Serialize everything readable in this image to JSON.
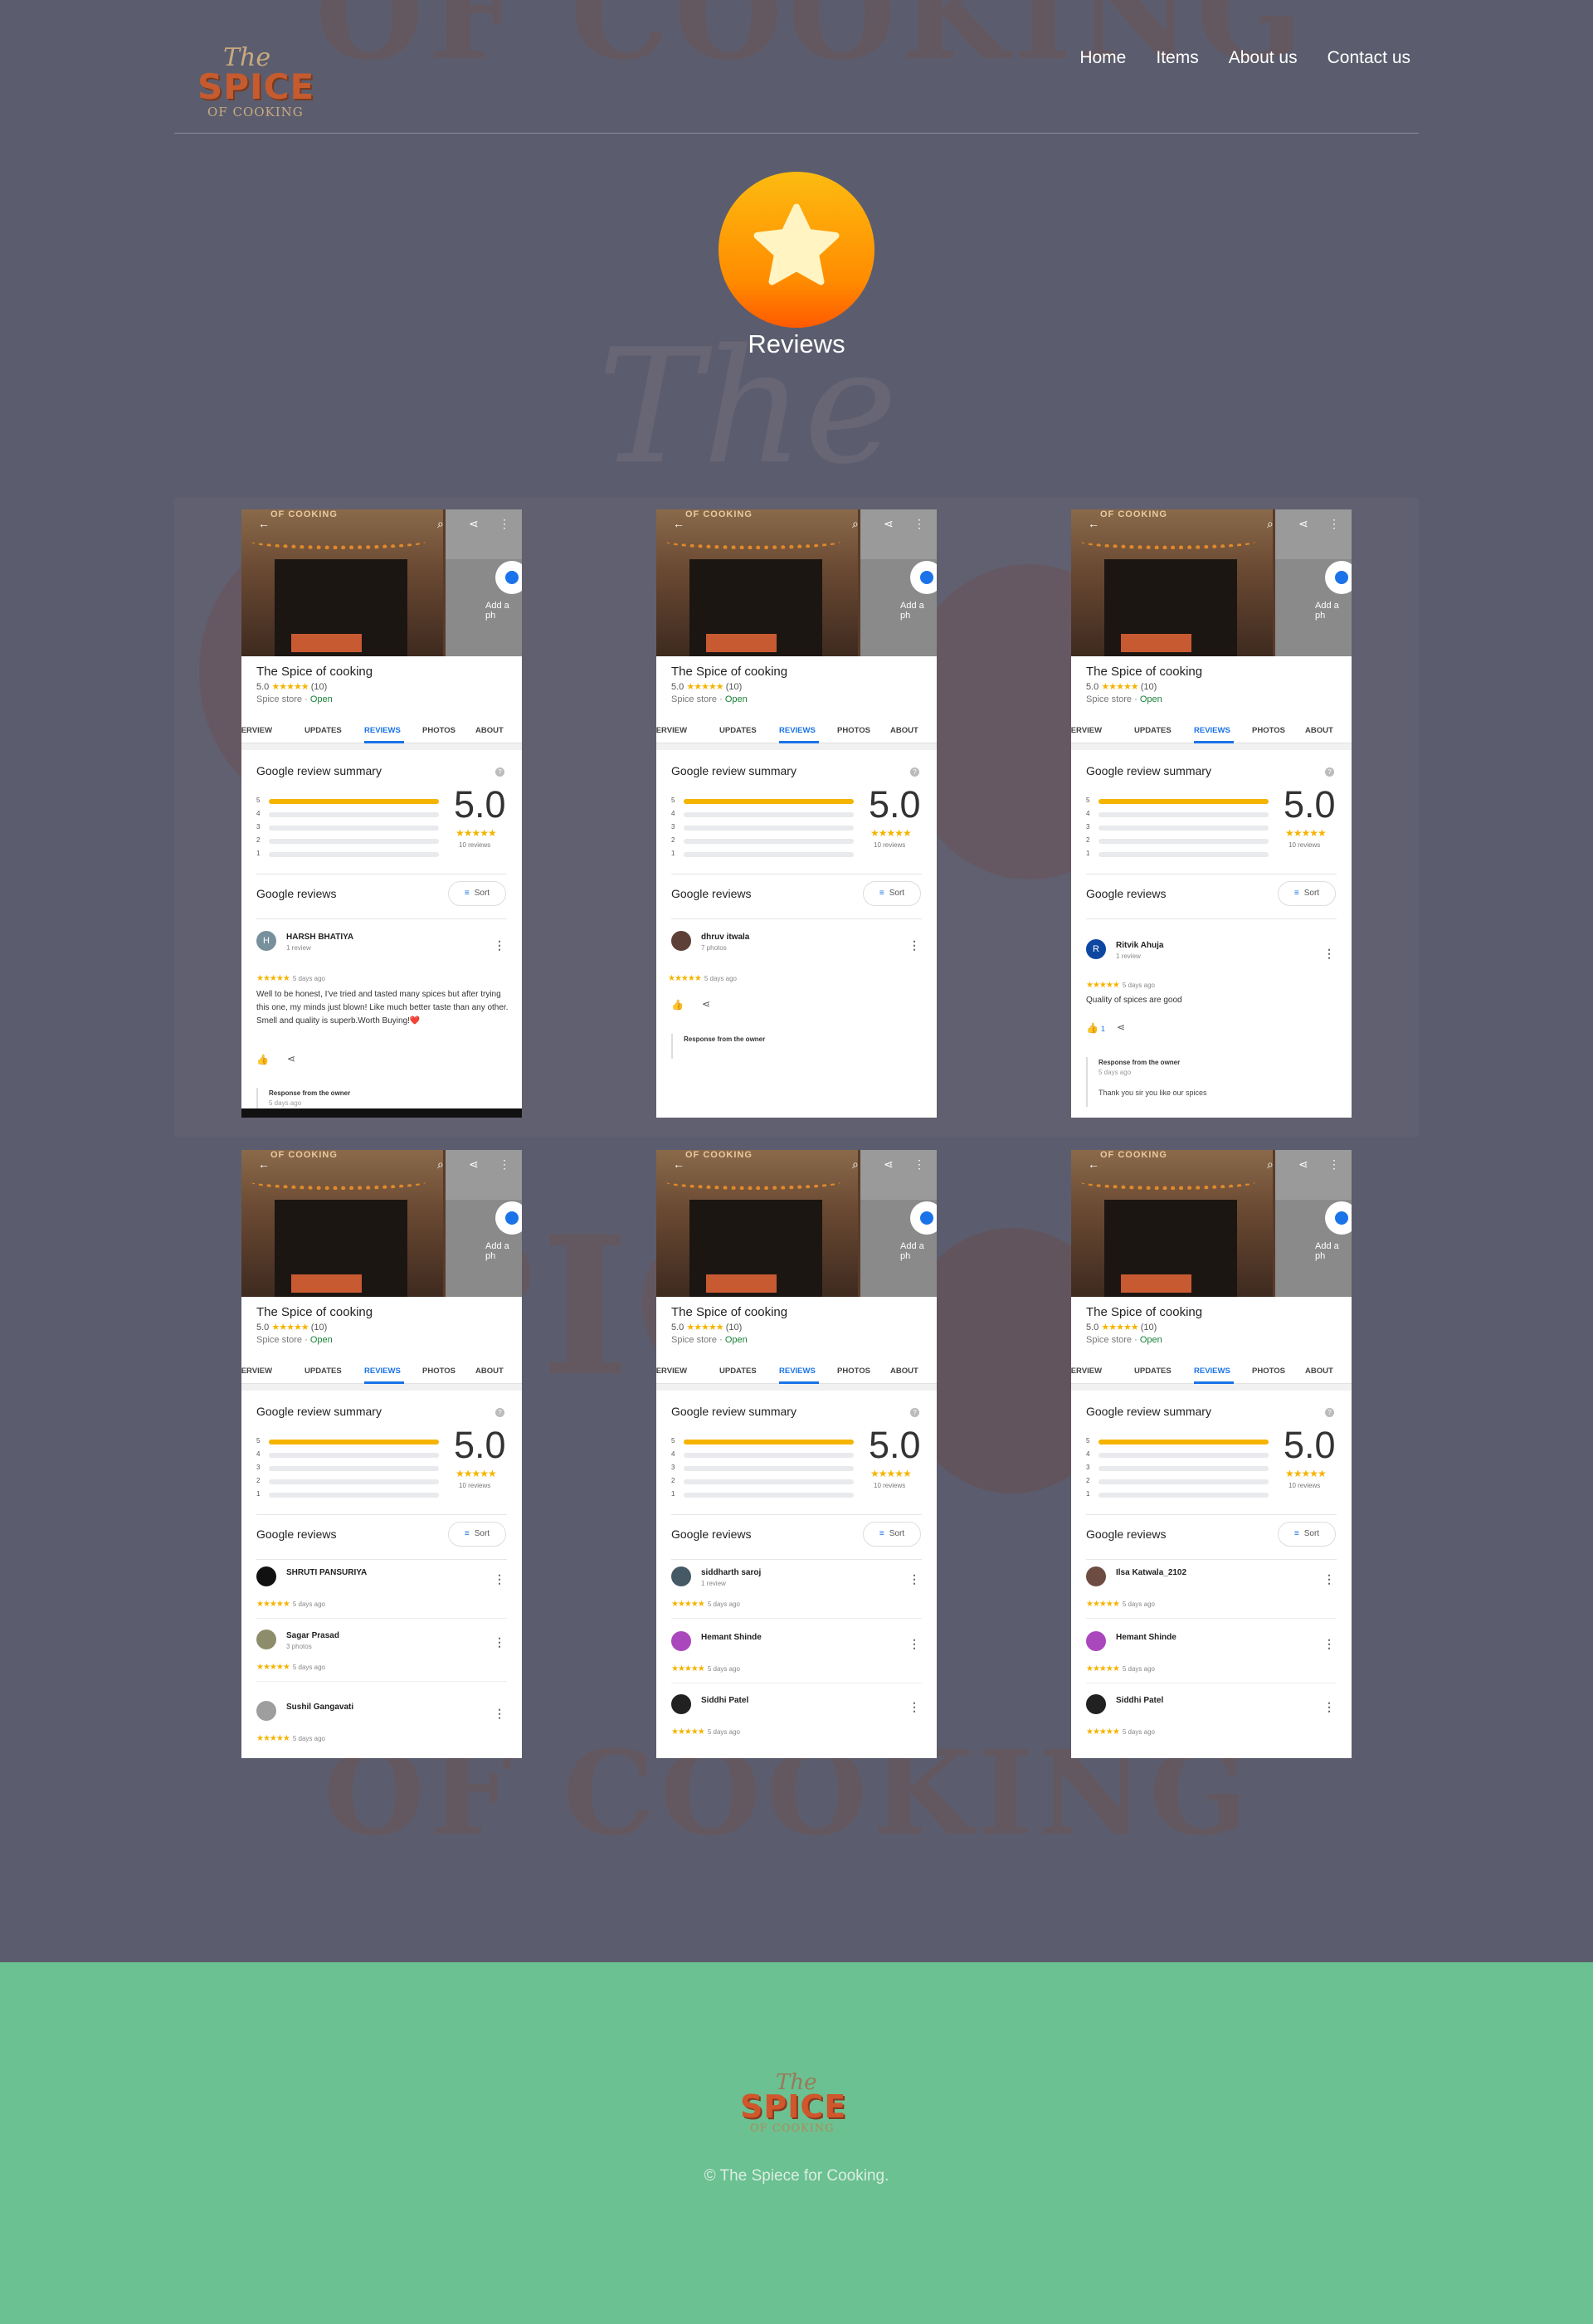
{
  "brand": {
    "logo_top": "The",
    "logo_mid": "SPICE",
    "logo_bottom": "OF COOKING"
  },
  "nav": [
    {
      "label": "Home"
    },
    {
      "label": "Items"
    },
    {
      "label": "About us"
    },
    {
      "label": "Contact us"
    }
  ],
  "hero": {
    "title": "Reviews",
    "icon": "star-icon",
    "icon_color": "#ff8c00"
  },
  "card_common": {
    "photo_top_text": "OF COOKING",
    "add_photo": "Add a ph",
    "biz_name": "The Spice of cooking",
    "biz_rating": "5.0",
    "biz_stars": "★★★★★",
    "biz_count": "(10)",
    "biz_type": "Spice store",
    "biz_open": "Open",
    "tabs": [
      "OVERVIEW",
      "UPDATES",
      "REVIEWS",
      "PHOTOS",
      "ABOUT"
    ],
    "summary_title": "Google review summary",
    "bars": [
      {
        "label": "5",
        "fraction": 1.0
      },
      {
        "label": "4",
        "fraction": 0
      },
      {
        "label": "3",
        "fraction": 0
      },
      {
        "label": "2",
        "fraction": 0
      },
      {
        "label": "1",
        "fraction": 0
      }
    ],
    "score": "5.0",
    "score_stars": "★★★★★",
    "review_count": "10 reviews",
    "reviews_title": "Google reviews",
    "sort_label": "Sort",
    "star_color": "#f5b400",
    "accent": "#1a73e8"
  },
  "cards": [
    {
      "reviews": [
        {
          "name": "HARSH BHATIYA",
          "sub": "1 review",
          "initial": "H",
          "avatar_color": "#78909c",
          "stars": "★★★★★",
          "ago": "5 days ago",
          "text": "Well to be honest, I've tried and tasted many spices but after trying this one, my minds just blown! Like much better taste than any other. Smell and quality is superb.Worth Buying!❤️"
        }
      ],
      "owner_label": "Response from the owner",
      "owner_ago": "5 days ago"
    },
    {
      "reviews": [
        {
          "name": "dhruv itwala",
          "sub": "7 photos",
          "initial": "",
          "avatar_color": "#5d4037",
          "stars": "★★★★★",
          "ago": "5 days ago",
          "text": ""
        }
      ],
      "owner_label": "Response from the owner"
    },
    {
      "reviews": [
        {
          "name": "Ritvik Ahuja",
          "sub": "1 review",
          "initial": "R",
          "avatar_color": "#0d47a1",
          "stars": "★★★★★",
          "ago": "5 days ago",
          "text": "Quality of spices are good"
        }
      ],
      "like_count": "1",
      "owner_label": "Response from the owner",
      "owner_ago": "5 days ago",
      "owner_text": "Thank you sir you like our spices"
    },
    {
      "reviews": [
        {
          "name": "SHRUTI PANSURIYA",
          "sub": "",
          "initial": "",
          "avatar_color": "#111111",
          "stars": "★★★★★",
          "ago": "5 days ago"
        },
        {
          "name": "Sagar Prasad",
          "sub": "3 photos",
          "initial": "",
          "avatar_color": "#8d8d6b",
          "stars": "★★★★★",
          "ago": "5 days ago"
        },
        {
          "name": "Sushil Gangavati",
          "sub": "",
          "initial": "",
          "avatar_color": "#9e9e9e",
          "stars": "★★★★★",
          "ago": "5 days ago"
        }
      ]
    },
    {
      "reviews": [
        {
          "name": "siddharth saroj",
          "sub": "1 review",
          "initial": "",
          "avatar_color": "#455a64",
          "stars": "★★★★★",
          "ago": "5 days ago"
        },
        {
          "name": "Hemant Shinde",
          "sub": "",
          "initial": "",
          "avatar_color": "#ab47bc",
          "stars": "★★★★★",
          "ago": "5 days ago"
        },
        {
          "name": "Siddhi Patel",
          "sub": "",
          "initial": "",
          "avatar_color": "#212121",
          "stars": "★★★★★",
          "ago": "5 days ago"
        }
      ]
    },
    {
      "reviews": [
        {
          "name": "Ilsa Katwala_2102",
          "sub": "",
          "initial": "",
          "avatar_color": "#6d4c41",
          "stars": "★★★★★",
          "ago": "5 days ago"
        },
        {
          "name": "Hemant Shinde",
          "sub": "",
          "initial": "",
          "avatar_color": "#ab47bc",
          "stars": "★★★★★",
          "ago": "5 days ago"
        },
        {
          "name": "Siddhi Patel",
          "sub": "",
          "initial": "",
          "avatar_color": "#212121",
          "stars": "★★★★★",
          "ago": "5 days ago"
        }
      ]
    }
  ],
  "background": {
    "word_top": "OF COOKING",
    "word_script": "The",
    "word_mid": "SPICE",
    "word_bottom": "OF COOKING"
  },
  "footer": {
    "copyright": "© The Spiece for Cooking.",
    "bg_color": "#6bc191"
  }
}
